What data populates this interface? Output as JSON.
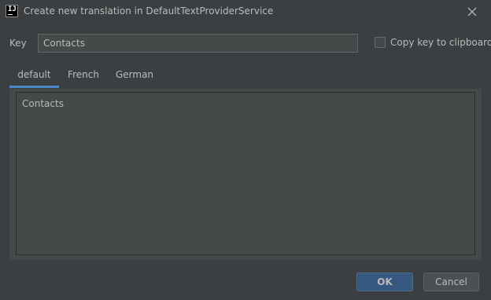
{
  "window": {
    "title": "Create new translation in DefaultTextProviderService",
    "app_icon_text": "IJ"
  },
  "form": {
    "key_label": "Key",
    "key_value": "Contacts",
    "copy_label": "Copy key to clipboard",
    "copy_checked": false
  },
  "tabs": [
    {
      "label": "default",
      "active": true
    },
    {
      "label": "French",
      "active": false
    },
    {
      "label": "German",
      "active": false
    }
  ],
  "editor": {
    "text": "Contacts"
  },
  "buttons": {
    "ok_label": "OK",
    "cancel_label": "Cancel"
  },
  "colors": {
    "background": "#3c3f41",
    "input_background": "#45494a",
    "accent": "#4a88c7",
    "primary_button": "#365880"
  }
}
